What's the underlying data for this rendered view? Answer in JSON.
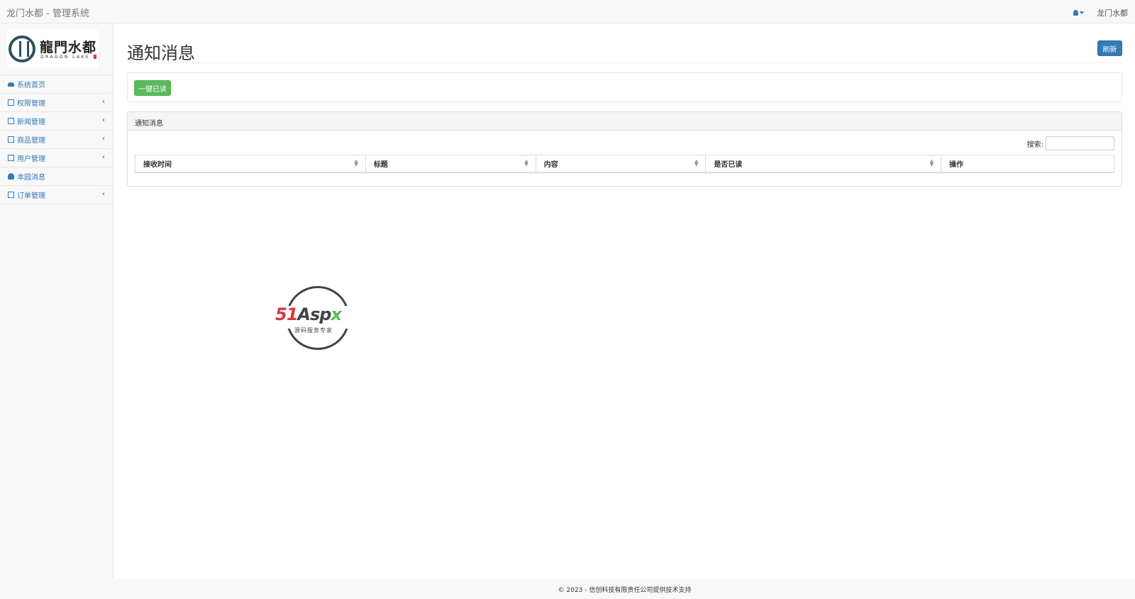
{
  "app": {
    "title": "龙门水都 - 管理系统"
  },
  "header": {
    "username": "龙门水都"
  },
  "logo": {
    "chinese": "龍門水都",
    "english": "DRAGON LAKE"
  },
  "sidebar": {
    "items": [
      {
        "label": "系统首页",
        "icon": "dashboard-icon",
        "expandable": false
      },
      {
        "label": "权限管理",
        "icon": "file-icon",
        "expandable": true
      },
      {
        "label": "新闻管理",
        "icon": "file-icon",
        "expandable": true
      },
      {
        "label": "商品管理",
        "icon": "file-icon",
        "expandable": true
      },
      {
        "label": "用户管理",
        "icon": "file-icon",
        "expandable": true
      },
      {
        "label": "本园消息",
        "icon": "user-icon",
        "expandable": false
      },
      {
        "label": "订单管理",
        "icon": "file-icon",
        "expandable": true
      }
    ]
  },
  "main": {
    "page_title": "通知消息",
    "refresh_label": "刷新",
    "mark_all_read_label": "一键已读",
    "panel_title": "通知消息",
    "search_label": "搜索:",
    "table": {
      "columns": [
        "接收时间",
        "标题",
        "内容",
        "是否已读",
        "操作"
      ]
    }
  },
  "watermark": {
    "text51": "51",
    "textAsp": "Asp",
    "textX": "x",
    "subtitle": "源码服务专家"
  },
  "footer": {
    "text": "© 2023 - 信创科技有限责任公司提供技术支持"
  },
  "colors": {
    "primary": "#337ab7",
    "success": "#5cb85c",
    "background": "#f8f8f8"
  }
}
